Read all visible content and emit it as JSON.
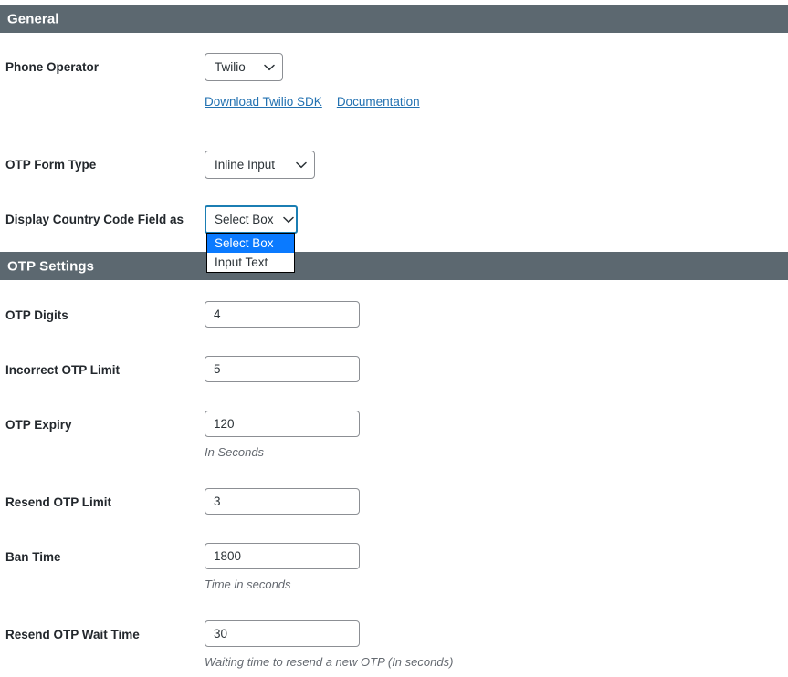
{
  "sections": {
    "general": {
      "title": "General"
    },
    "otp": {
      "title": "OTP Settings"
    }
  },
  "general": {
    "phone_operator": {
      "label": "Phone Operator",
      "value": "Twilio"
    },
    "links": {
      "download_sdk": "Download Twilio SDK",
      "documentation": "Documentation"
    },
    "otp_form_type": {
      "label": "OTP Form Type",
      "value": "Inline Input"
    },
    "country_code_field": {
      "label": "Display Country Code Field as",
      "value": "Select Box",
      "options": [
        {
          "label": "Select Box",
          "selected": true
        },
        {
          "label": "Input Text",
          "selected": false
        }
      ]
    }
  },
  "otp_settings": {
    "otp_digits": {
      "label": "OTP Digits",
      "value": "4",
      "hint": ""
    },
    "incorrect_otp_limit": {
      "label": "Incorrect OTP Limit",
      "value": "5",
      "hint": ""
    },
    "otp_expiry": {
      "label": "OTP Expiry",
      "value": "120",
      "hint": "In Seconds"
    },
    "resend_otp_limit": {
      "label": "Resend OTP Limit",
      "value": "3",
      "hint": ""
    },
    "ban_time": {
      "label": "Ban Time",
      "value": "1800",
      "hint": "Time in seconds"
    },
    "resend_otp_wait_time": {
      "label": "Resend OTP Wait Time",
      "value": "30",
      "hint": "Waiting time to resend a new OTP (In seconds)"
    }
  },
  "colors": {
    "section_bar": "#5c6870",
    "link": "#2271b1",
    "focus_border": "#1b7eb3",
    "option_highlight": "#0a7aff",
    "label_text": "#23282d",
    "hint_text": "#646970"
  }
}
